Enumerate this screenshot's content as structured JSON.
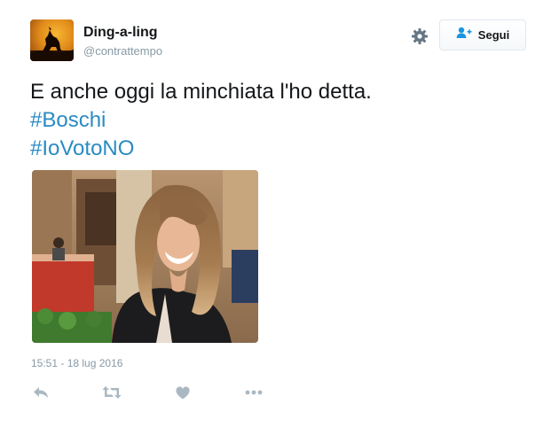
{
  "user": {
    "display_name": "Ding-a-ling",
    "handle": "@contrattempo",
    "avatar_icon": "howling-wolf-at-sunset"
  },
  "header": {
    "follow_label": "Segui",
    "settings_icon": "gear-icon",
    "follow_icon": "add-person-icon"
  },
  "tweet": {
    "text_lines": [
      "E anche oggi la minchiata l'ho detta."
    ],
    "hashtags": [
      "#Boschi",
      "#IoVotoNO"
    ],
    "timestamp": "15:51 - 18 lug 2016"
  },
  "actions": [
    {
      "name": "reply",
      "icon": "reply-icon"
    },
    {
      "name": "retweet",
      "icon": "retweet-icon"
    },
    {
      "name": "like",
      "icon": "heart-icon"
    },
    {
      "name": "more",
      "icon": "more-dots-icon"
    }
  ],
  "colors": {
    "hashtag": "#2a8bc3",
    "icon_gray": "#aab8c2",
    "handle_gray": "#8899a6"
  }
}
